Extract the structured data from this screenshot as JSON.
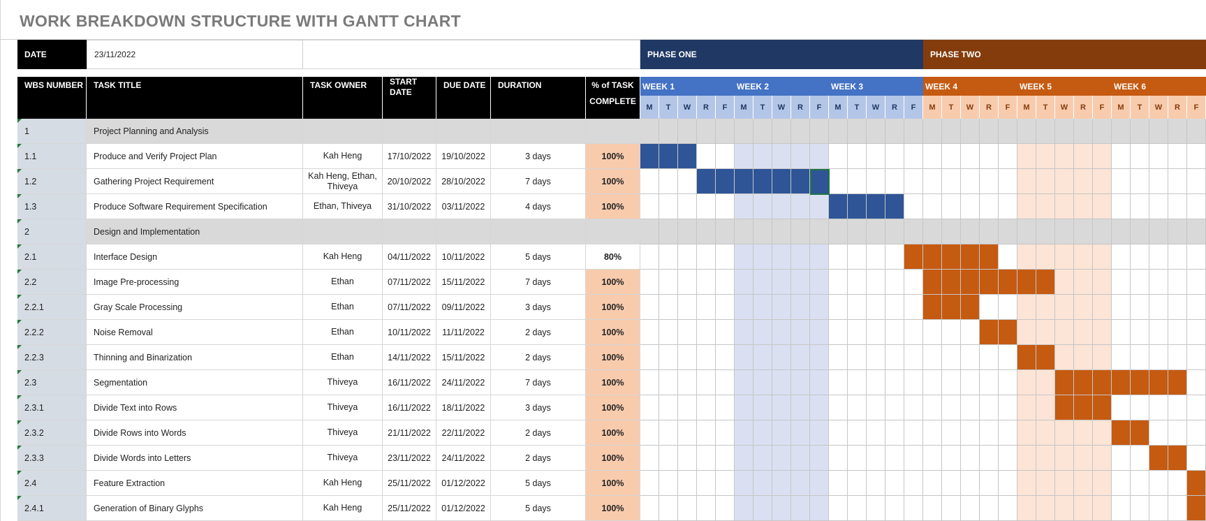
{
  "title": "WORK BREAKDOWN STRUCTURE WITH GANTT CHART",
  "date_label": "DATE",
  "date_value": "23/11/2022",
  "phases": [
    {
      "label": "PHASE ONE",
      "color": "#203864"
    },
    {
      "label": "PHASE TWO",
      "color": "#843c0c"
    }
  ],
  "columns": {
    "wbs": "WBS NUMBER",
    "task": "TASK TITLE",
    "owner": "TASK OWNER",
    "start": "START DATE",
    "due": "DUE DATE",
    "duration": "DURATION",
    "pct_line1": "% of TASK",
    "pct_line2": "COMPLETE"
  },
  "weeks": [
    "WEEK 1",
    "WEEK 2",
    "WEEK 3",
    "WEEK 4",
    "WEEK 5",
    "WEEK 6"
  ],
  "days": [
    "M",
    "T",
    "W",
    "R",
    "F"
  ],
  "colors": {
    "phase_one_bar": "#2f5597",
    "phase_two_bar": "#c55a11",
    "phase_one_week_header": "#4472c4",
    "phase_two_week_header": "#c55a11",
    "phase_one_day_header": "#b4c6e7",
    "phase_two_day_header": "#f8cbad",
    "phase_one_week_shade": "#dae0f2",
    "phase_two_week_shade": "#fce4d6",
    "section_row": "#d9d9d9",
    "pct_cell": "#f8cbad",
    "wbs_cell": "#d6dce4"
  },
  "rows": [
    {
      "wbs": "1",
      "task": "Project Planning and Analysis",
      "owner": "",
      "start": "",
      "due": "",
      "duration": "",
      "pct": "",
      "section": true
    },
    {
      "wbs": "1.1",
      "task": "Produce and Verify Project Plan",
      "owner": "Kah Heng",
      "start": "17/10/2022",
      "due": "19/10/2022",
      "duration": "3 days",
      "pct": "100%",
      "bar": {
        "from_day": 1,
        "to_day": 3,
        "phase": 1
      }
    },
    {
      "wbs": "1.2",
      "task": "Gathering Project Requirement",
      "owner": "Kah Heng, Ethan, Thiveya",
      "start": "20/10/2022",
      "due": "28/10/2022",
      "duration": "7 days",
      "pct": "100%",
      "bar": {
        "from_day": 4,
        "to_day": 10,
        "phase": 1
      }
    },
    {
      "wbs": "1.3",
      "task": "Produce Software Requirement Specification",
      "owner": "Ethan, Thiveya",
      "start": "31/10/2022",
      "due": "03/11/2022",
      "duration": "4 days",
      "pct": "100%",
      "bar": {
        "from_day": 11,
        "to_day": 14,
        "phase": 1
      }
    },
    {
      "wbs": "2",
      "task": "Design and Implementation",
      "owner": "",
      "start": "",
      "due": "",
      "duration": "",
      "pct": "",
      "section": true
    },
    {
      "wbs": "2.1",
      "task": "Interface Design",
      "owner": "Kah Heng",
      "start": "04/11/2022",
      "due": "10/11/2022",
      "duration": "5 days",
      "pct": "80%",
      "bar": {
        "from_day": 15,
        "to_day": 19,
        "phase": 2
      }
    },
    {
      "wbs": "2.2",
      "task": "Image Pre-processing",
      "owner": "Ethan",
      "start": "07/11/2022",
      "due": "15/11/2022",
      "duration": "7 days",
      "pct": "100%",
      "bar": {
        "from_day": 16,
        "to_day": 22,
        "phase": 2
      }
    },
    {
      "wbs": "2.2.1",
      "task": "Gray Scale Processing",
      "owner": "Ethan",
      "start": "07/11/2022",
      "due": "09/11/2022",
      "duration": "3 days",
      "pct": "100%",
      "bar": {
        "from_day": 16,
        "to_day": 18,
        "phase": 2
      }
    },
    {
      "wbs": "2.2.2",
      "task": "Noise Removal",
      "owner": "Ethan",
      "start": "10/11/2022",
      "due": "11/11/2022",
      "duration": "2 days",
      "pct": "100%",
      "bar": {
        "from_day": 19,
        "to_day": 20,
        "phase": 2
      }
    },
    {
      "wbs": "2.2.3",
      "task": "Thinning and Binarization",
      "owner": "Ethan",
      "start": "14/11/2022",
      "due": "15/11/2022",
      "duration": "2 days",
      "pct": "100%",
      "bar": {
        "from_day": 21,
        "to_day": 22,
        "phase": 2
      }
    },
    {
      "wbs": "2.3",
      "task": "Segmentation",
      "owner": "Thiveya",
      "start": "16/11/2022",
      "due": "24/11/2022",
      "duration": "7 days",
      "pct": "100%",
      "bar": {
        "from_day": 23,
        "to_day": 29,
        "phase": 2
      }
    },
    {
      "wbs": "2.3.1",
      "task": "Divide Text into Rows",
      "owner": "Thiveya",
      "start": "16/11/2022",
      "due": "18/11/2022",
      "duration": "3 days",
      "pct": "100%",
      "bar": {
        "from_day": 23,
        "to_day": 25,
        "phase": 2
      }
    },
    {
      "wbs": "2.3.2",
      "task": "Divide Rows into Words",
      "owner": "Thiveya",
      "start": "21/11/2022",
      "due": "22/11/2022",
      "duration": "2 days",
      "pct": "100%",
      "bar": {
        "from_day": 26,
        "to_day": 27,
        "phase": 2
      }
    },
    {
      "wbs": "2.3.3",
      "task": "Divide Words into Letters",
      "owner": "Thiveya",
      "start": "23/11/2022",
      "due": "24/11/2022",
      "duration": "2 days",
      "pct": "100%",
      "bar": {
        "from_day": 28,
        "to_day": 29,
        "phase": 2
      }
    },
    {
      "wbs": "2.4",
      "task": "Feature Extraction",
      "owner": "Kah Heng",
      "start": "25/11/2022",
      "due": "01/12/2022",
      "duration": "5 days",
      "pct": "100%",
      "bar": {
        "from_day": 30,
        "to_day": 30,
        "phase": 2
      }
    },
    {
      "wbs": "2.4.1",
      "task": "Generation of Binary Glyphs",
      "owner": "Kah Heng",
      "start": "25/11/2022",
      "due": "01/12/2022",
      "duration": "5 days",
      "pct": "100%",
      "bar": {
        "from_day": 30,
        "to_day": 30,
        "phase": 2
      }
    }
  ]
}
